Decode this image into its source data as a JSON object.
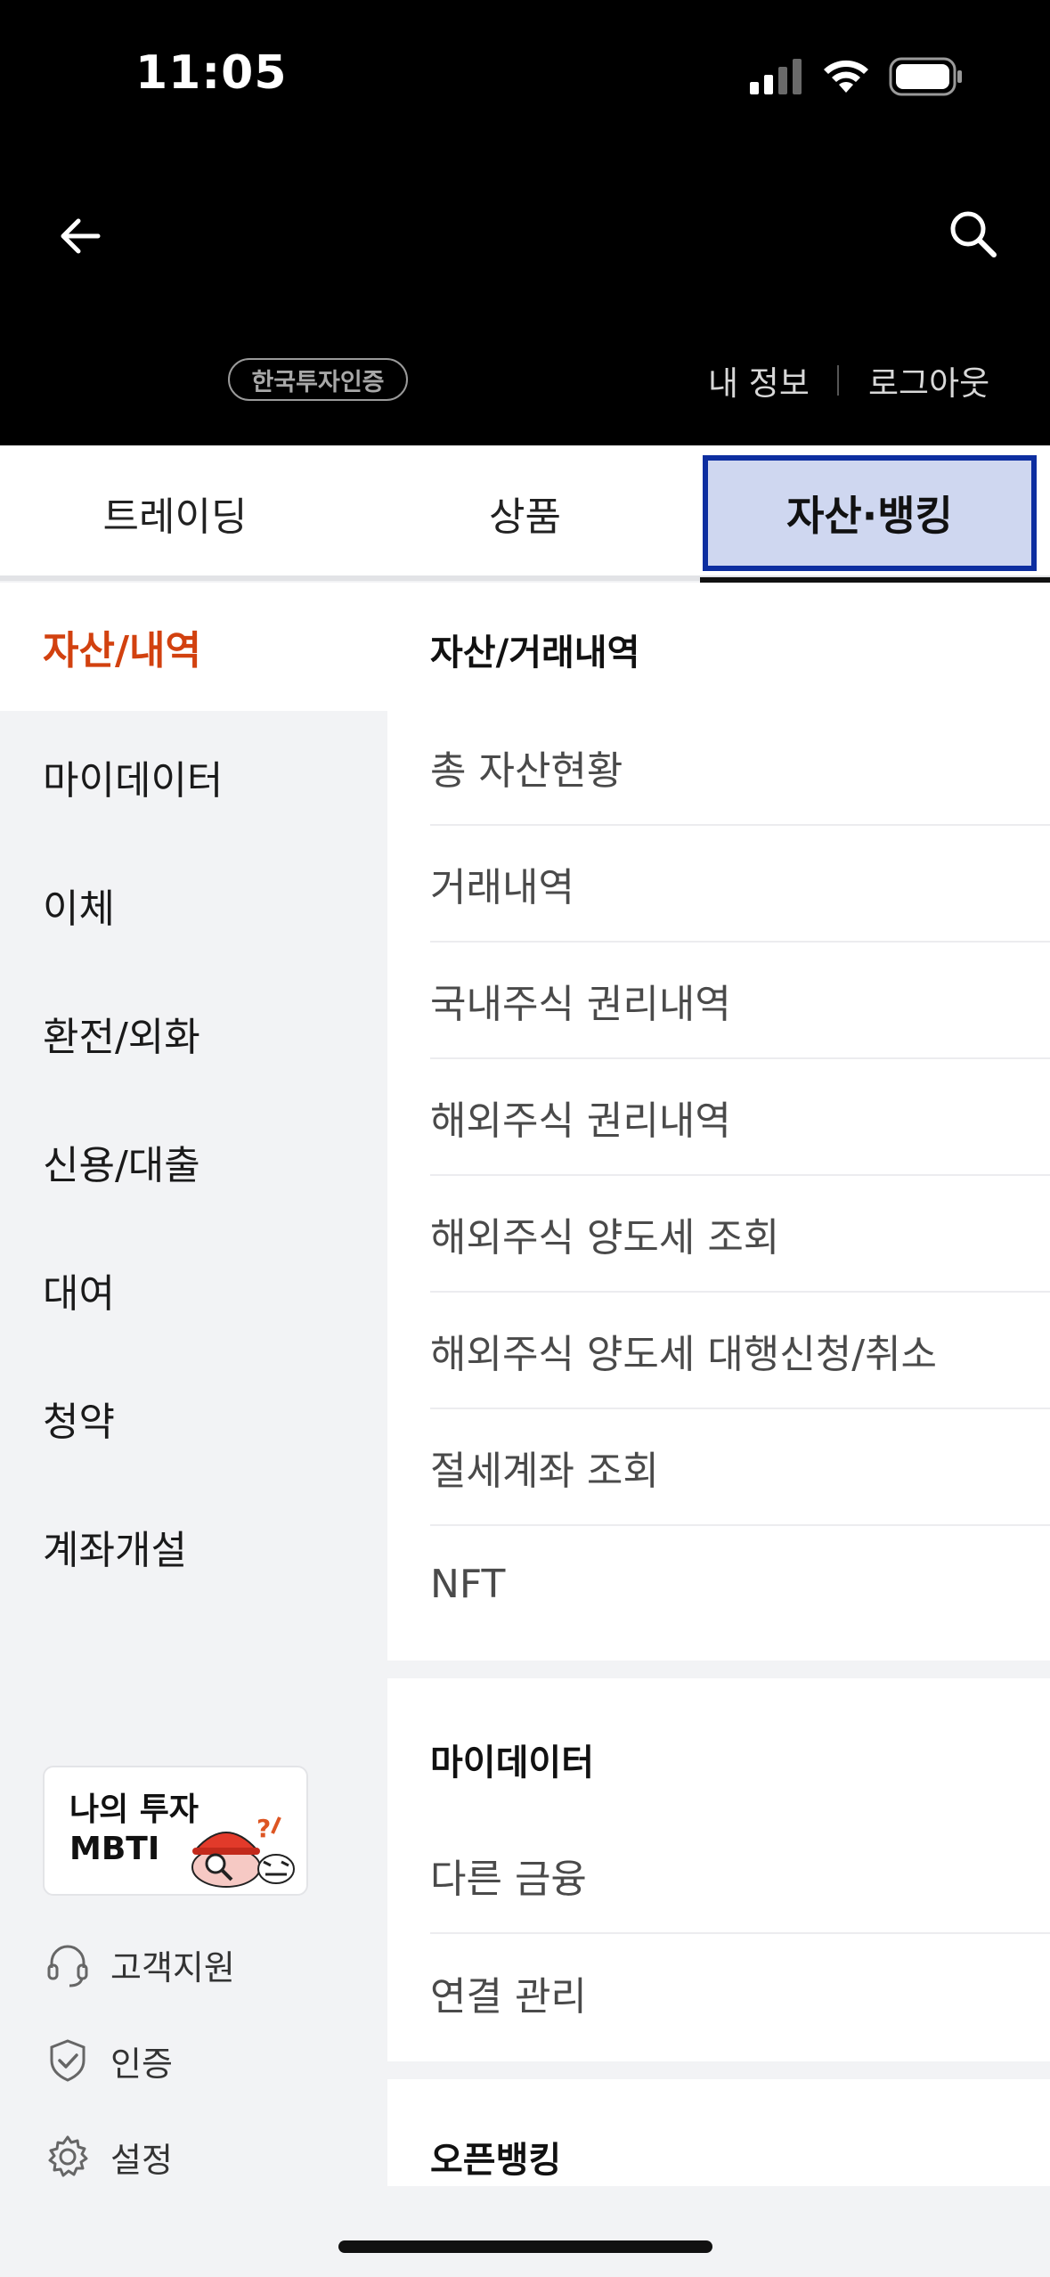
{
  "status_bar": {
    "time": "11:05"
  },
  "header": {
    "cert_badge": "한국투자인증",
    "my_info": "내 정보",
    "logout": "로그아웃"
  },
  "tabs": [
    {
      "label": "트레이딩"
    },
    {
      "label": "상품"
    },
    {
      "label": "자산·뱅킹",
      "selected": true
    }
  ],
  "sidebar": {
    "items": [
      {
        "label": "자산/내역",
        "active": true
      },
      {
        "label": "마이데이터"
      },
      {
        "label": "이체"
      },
      {
        "label": "환전/외화"
      },
      {
        "label": "신용/대출"
      },
      {
        "label": "대여"
      },
      {
        "label": "청약"
      },
      {
        "label": "계좌개설"
      }
    ],
    "mbti_card": {
      "line1": "나의 투자",
      "line2": "MBTI"
    },
    "utilities": [
      {
        "label": "고객지원",
        "icon": "headset-icon"
      },
      {
        "label": "인증",
        "icon": "shield-check-icon"
      },
      {
        "label": "설정",
        "icon": "gear-icon"
      }
    ]
  },
  "content": {
    "sections": [
      {
        "title": "자산/거래내역",
        "items": [
          "총 자산현황",
          "거래내역",
          "국내주식 권리내역",
          "해외주식 권리내역",
          "해외주식 양도세 조회",
          "해외주식 양도세 대행신청/취소",
          "절세계좌 조회",
          "NFT"
        ]
      },
      {
        "title": "마이데이터",
        "items": [
          "다른 금융",
          "연결 관리"
        ]
      },
      {
        "title": "오픈뱅킹",
        "items": []
      }
    ]
  },
  "colors": {
    "active_sidebar": "#d2410f",
    "selected_tab_fill": "#cfd7f0",
    "selected_tab_border": "#0d2ea0"
  }
}
